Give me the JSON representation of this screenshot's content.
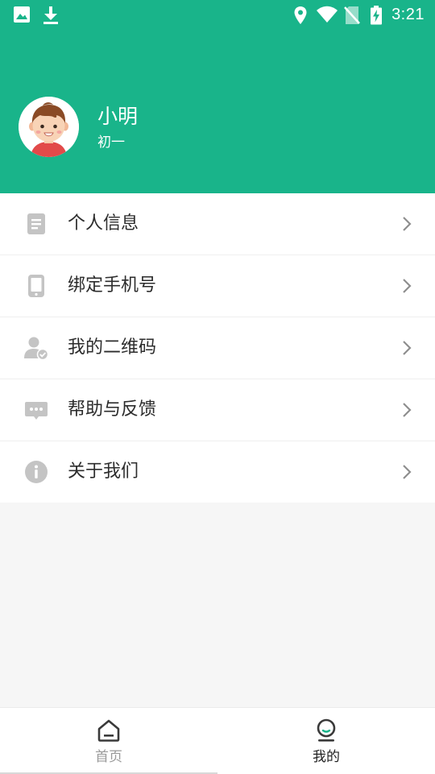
{
  "status_bar": {
    "time": "3:21",
    "icons": [
      "image-icon",
      "download-icon",
      "location-icon",
      "wifi-icon",
      "no-sim-icon",
      "battery-charging-icon"
    ]
  },
  "profile": {
    "name": "小明",
    "grade": "初一"
  },
  "menu": [
    {
      "label": "个人信息",
      "icon": "document-icon"
    },
    {
      "label": "绑定手机号",
      "icon": "phone-icon"
    },
    {
      "label": "我的二维码",
      "icon": "user-verified-icon"
    },
    {
      "label": "帮助与反馈",
      "icon": "chat-bubble-icon"
    },
    {
      "label": "关于我们",
      "icon": "info-icon"
    }
  ],
  "tabs": [
    {
      "label": "首页",
      "icon": "home-icon",
      "active": false
    },
    {
      "label": "我的",
      "icon": "profile-icon",
      "active": true
    }
  ],
  "colors": {
    "brand": "#19b48a",
    "icon_gray": "#c4c4c4",
    "background": "#f6f6f6"
  }
}
